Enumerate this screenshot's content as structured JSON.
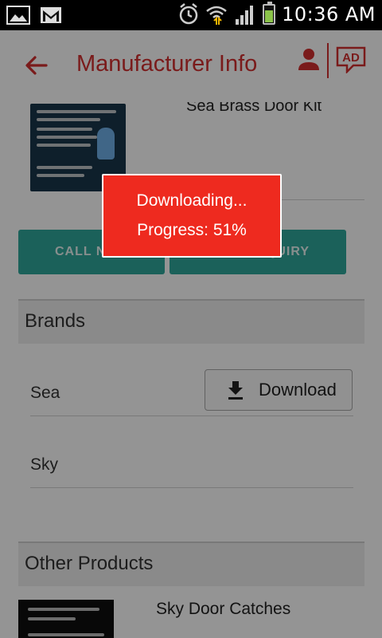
{
  "status_bar": {
    "time": "10:36 AM",
    "icons": [
      "image-icon",
      "gmail-icon",
      "alarm-icon",
      "wifi-icon",
      "signal-icon",
      "battery-icon"
    ]
  },
  "app_bar": {
    "title": "Manufacturer Info",
    "back_icon": "arrow-back-icon",
    "user_icon": "person-icon",
    "ad_icon": "ad-icon",
    "accent_color": "#d32f2f"
  },
  "product_top": {
    "name": "Sea Brass Door Kit"
  },
  "actions": {
    "call_label": "CALL NOW",
    "enquiry_label": "SEND ENQUIRY",
    "button_color": "#2fa89c"
  },
  "brands": {
    "header": "Brands",
    "items": [
      {
        "name": "Sea",
        "download_label": "Download"
      },
      {
        "name": "Sky"
      }
    ]
  },
  "other_products": {
    "header": "Other Products",
    "items": [
      {
        "name": "Sky Door Catches"
      }
    ]
  },
  "download_dialog": {
    "line1": "Downloading...",
    "progress_label": "Progress: 51%",
    "progress": 0.51,
    "color": "#ee2a1f"
  }
}
